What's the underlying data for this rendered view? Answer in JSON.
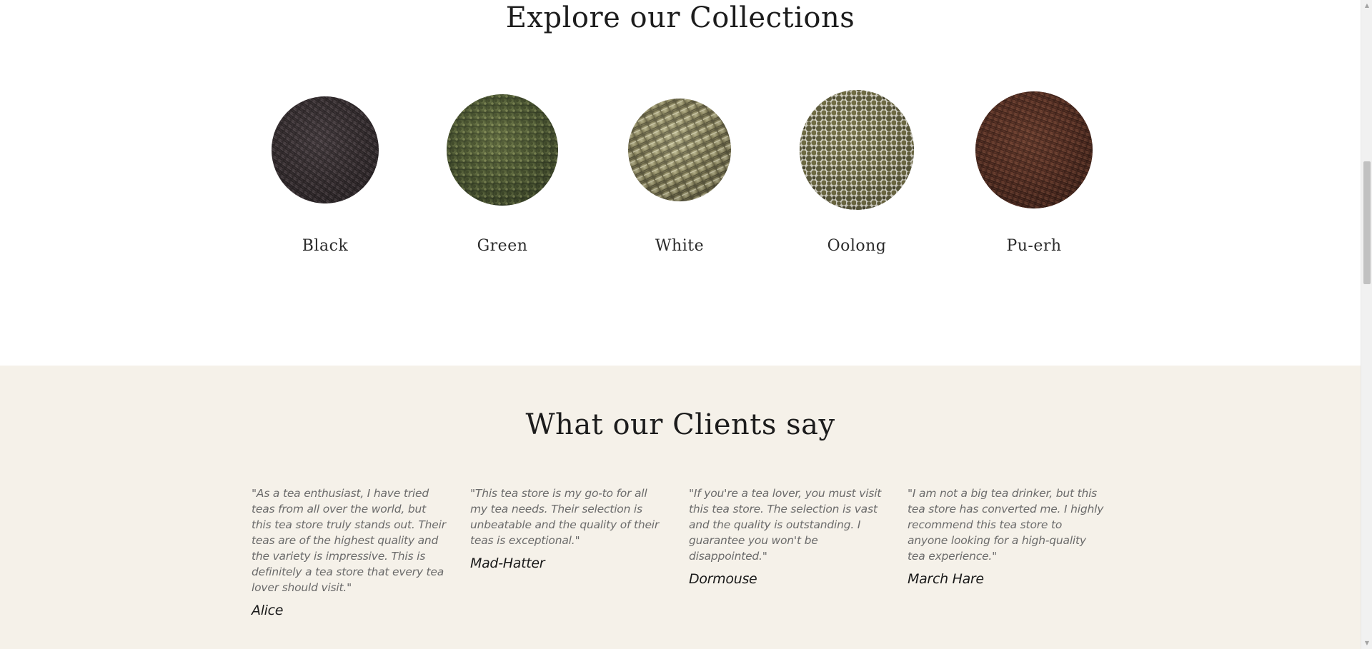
{
  "collections": {
    "title": "Explore our Collections",
    "items": [
      {
        "label": "Black",
        "icon": "black-tea-leaves-image",
        "color": "#3a3234"
      },
      {
        "label": "Green",
        "icon": "green-tea-leaves-image",
        "color": "#4f5a35"
      },
      {
        "label": "White",
        "icon": "white-tea-leaves-image",
        "color": "#8b8660"
      },
      {
        "label": "Oolong",
        "icon": "oolong-tea-leaves-image",
        "color": "#5e5c3c"
      },
      {
        "label": "Pu-erh",
        "icon": "pu-erh-tea-leaves-image",
        "color": "#5a3327"
      }
    ]
  },
  "testimonials": {
    "title": "What our Clients say",
    "background": "#f5f1e9",
    "items": [
      {
        "quote": "\"As a tea enthusiast, I have tried teas from all over the world, but this tea store truly stands out. Their teas are of the highest quality and the variety is impressive. This is definitely a tea store that every tea lover should visit.\"",
        "author": "Alice"
      },
      {
        "quote": "\"This tea store is my go-to for all my tea needs. Their selection is unbeatable and the quality of their teas is exceptional.\"",
        "author": "Mad-Hatter"
      },
      {
        "quote": "\"If you're a tea lover, you must visit this tea store. The selection is vast and the quality is outstanding. I guarantee you won't be disappointed.\"",
        "author": "Dormouse"
      },
      {
        "quote": "\"I am not a big tea drinker, but this tea store has converted me. I highly recommend this tea store to anyone looking for a high-quality tea experience.\"",
        "author": "March Hare"
      }
    ]
  },
  "scrollbar": {
    "up_icon": "scroll-up-arrow-icon",
    "down_icon": "scroll-down-arrow-icon"
  }
}
